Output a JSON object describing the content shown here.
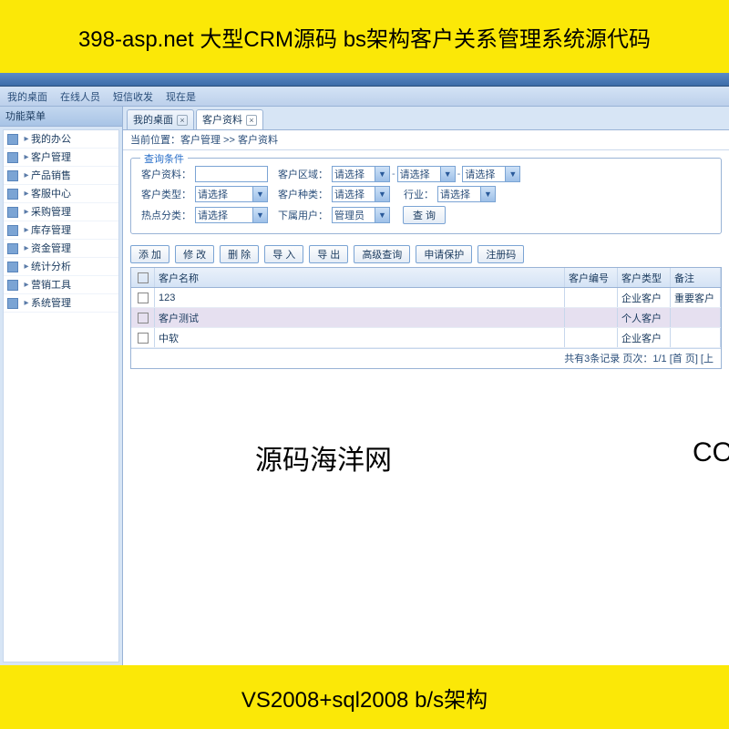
{
  "banner_top": "398-asp.net 大型CRM源码 bs架构客户关系管理系统源代码",
  "banner_bottom": "VS2008+sql2008 b/s架构",
  "toolbar": {
    "desktop": "我的桌面",
    "online": "在线人员",
    "sms": "短信收发",
    "now": "现在是"
  },
  "sidebar": {
    "title": "功能菜单",
    "items": [
      {
        "label": "我的办公"
      },
      {
        "label": "客户管理"
      },
      {
        "label": "产品销售"
      },
      {
        "label": "客服中心"
      },
      {
        "label": "采购管理"
      },
      {
        "label": "库存管理"
      },
      {
        "label": "资金管理"
      },
      {
        "label": "统计分析"
      },
      {
        "label": "营销工具"
      },
      {
        "label": "系统管理"
      }
    ]
  },
  "tabs": {
    "desktop": "我的桌面",
    "customer": "客户资料"
  },
  "breadcrumb": "当前位置：客户管理 >> 客户资料",
  "query": {
    "legend": "查询条件",
    "info_lbl": "客户资料：",
    "region_lbl": "客户区域：",
    "type_lbl": "客户类型：",
    "kind_lbl": "客户种类：",
    "industry_lbl": "行业：",
    "hot_lbl": "热点分类：",
    "sub_lbl": "下属用户：",
    "please_select": "请选择",
    "admin": "管理员",
    "btn_query": "查 询"
  },
  "buttons": {
    "add": "添 加",
    "edit": "修 改",
    "del": "删 除",
    "imp": "导 入",
    "exp": "导 出",
    "adv": "高级查询",
    "protect": "申请保护",
    "reg": "注册码"
  },
  "grid": {
    "col_name": "客户名称",
    "col_id": "客户编号",
    "col_type": "客户类型",
    "col_remark": "备注",
    "rows": [
      {
        "name": "123",
        "id": "",
        "type": "企业客户",
        "remark": "重要客户"
      },
      {
        "name": "客户测试",
        "id": "",
        "type": "个人客户",
        "remark": ""
      },
      {
        "name": "中软",
        "id": "",
        "type": "企业客户",
        "remark": ""
      }
    ]
  },
  "pager": "共有3条记录 页次：1/1 [首 页] [上",
  "watermark": "源码海洋网",
  "watermark2": "CO"
}
